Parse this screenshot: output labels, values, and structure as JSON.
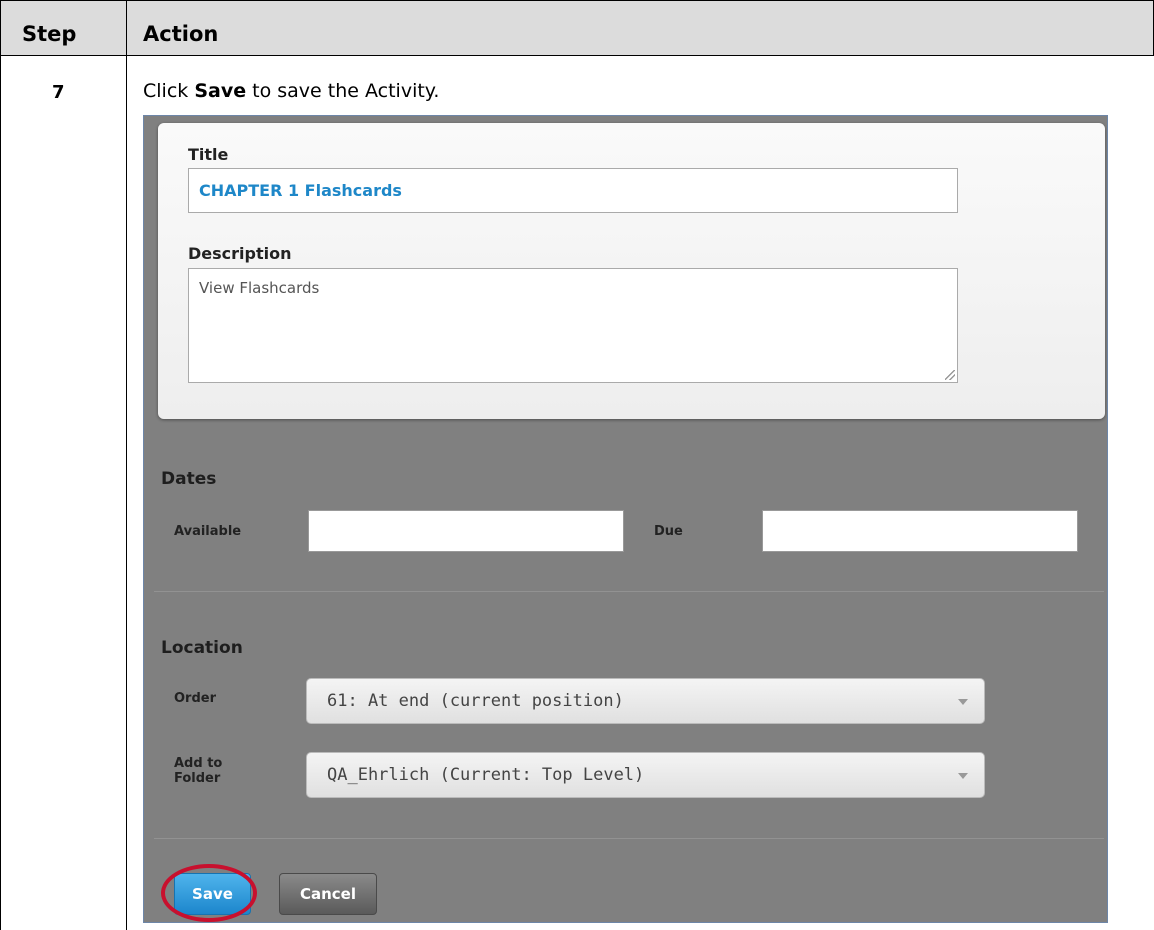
{
  "table": {
    "header_step": "Step",
    "header_action": "Action",
    "step_number": "7",
    "instruction_prefix": "Click ",
    "instruction_bold": "Save",
    "instruction_suffix": " to save the Activity."
  },
  "form": {
    "title_label": "Title",
    "title_value": "CHAPTER 1 Flashcards",
    "description_label": "Description",
    "description_value": "View Flashcards",
    "dates_heading": "Dates",
    "available_label": "Available",
    "available_value": "",
    "due_label": "Due",
    "due_value": "",
    "location_heading": "Location",
    "order_label": "Order",
    "order_value": "61: At end (current position)",
    "folder_label_line1": "Add to",
    "folder_label_line2": "Folder",
    "folder_value": "QA_Ehrlich (Current: Top Level)",
    "save_label": "Save",
    "cancel_label": "Cancel"
  },
  "colors": {
    "title_text": "#1e87c8",
    "save_button": "#1c86cc",
    "highlight_ring": "#c8102e",
    "panel_background": "#808080"
  },
  "icons": {
    "dropdown": "caret-down-icon",
    "textarea_resize": "resize-grip-icon"
  }
}
